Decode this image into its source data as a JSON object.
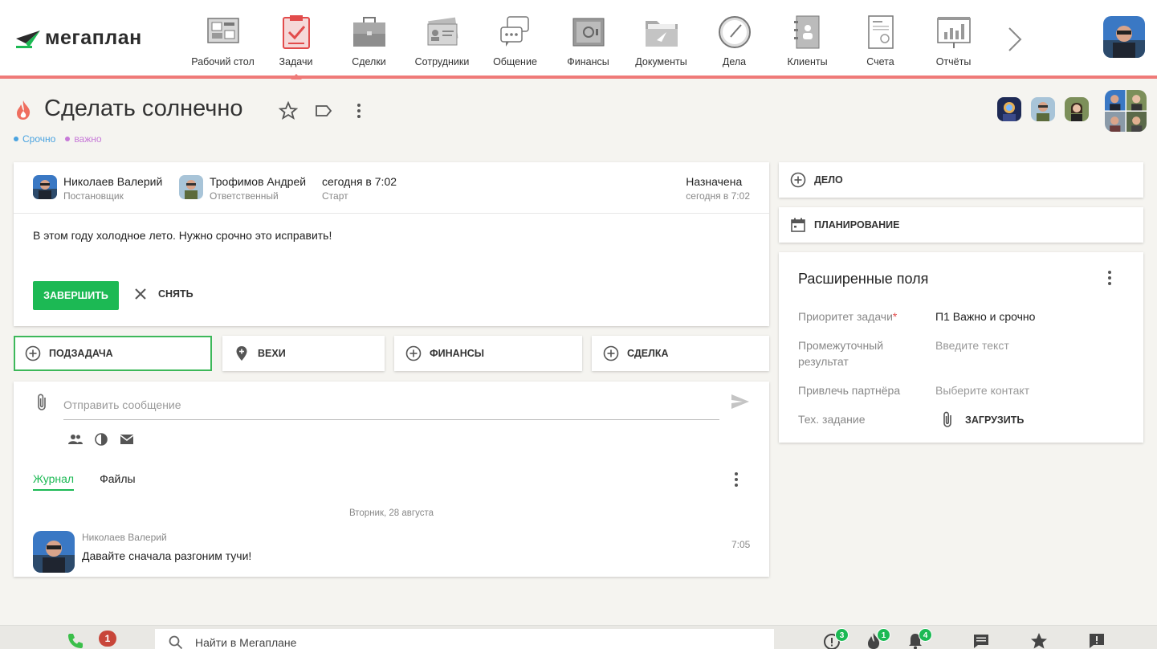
{
  "app": {
    "logo_text": "мегаплан",
    "accent_color": "#1cb954",
    "brand_bar_color": "#ef7a78"
  },
  "nav": {
    "items": [
      {
        "label": "Рабочий стол",
        "icon": "desktop-icon"
      },
      {
        "label": "Задачи",
        "icon": "tasks-clipboard-icon",
        "active": true
      },
      {
        "label": "Сделки",
        "icon": "briefcase-icon"
      },
      {
        "label": "Сотрудники",
        "icon": "id-card-icon"
      },
      {
        "label": "Общение",
        "icon": "chat-bubbles-icon"
      },
      {
        "label": "Финансы",
        "icon": "safe-icon"
      },
      {
        "label": "Документы",
        "icon": "folder-icon"
      },
      {
        "label": "Дела",
        "icon": "clock-icon"
      },
      {
        "label": "Клиенты",
        "icon": "contacts-book-icon"
      },
      {
        "label": "Счета",
        "icon": "invoice-icon"
      },
      {
        "label": "Отчёты",
        "icon": "report-chart-icon"
      }
    ]
  },
  "task": {
    "title": "Сделать солнечно",
    "tags": [
      {
        "label": "Срочно",
        "color": "#4aa3e0"
      },
      {
        "label": "важно",
        "color": "#c77ad8"
      }
    ],
    "owner": {
      "name": "Николаев Валерий",
      "role": "Постановщик"
    },
    "responsible": {
      "name": "Трофимов Андрей",
      "role": "Ответственный"
    },
    "start": {
      "value": "сегодня в 7:02",
      "label": "Старт"
    },
    "status": {
      "value": "Назначена",
      "time": "сегодня в 7:02"
    },
    "description": "В этом году холодное лето. Нужно срочно это исправить!",
    "complete_label": "ЗАВЕРШИТЬ",
    "remove_label": "СНЯТЬ"
  },
  "chips": {
    "subtask": "ПОДЗАДАЧА",
    "milestones": "ВЕХИ",
    "finance": "ФИНАНСЫ",
    "deal": "СДЕЛКА"
  },
  "message": {
    "placeholder": "Отправить сообщение"
  },
  "journal": {
    "tabs": [
      "Журнал",
      "Файлы"
    ],
    "date_separator": "Вторник, 28 августа",
    "entries": [
      {
        "author": "Николаев Валерий",
        "text": "Давайте сначала разгоним тучи!",
        "time": "7:05"
      }
    ]
  },
  "side": {
    "task_button": "ДЕЛО",
    "planning_button": "ПЛАНИРОВАНИЕ",
    "ext_title": "Расширенные поля",
    "fields": {
      "priority_label": "Приоритет задачи",
      "priority_required": "*",
      "priority_value": "П1 Важно и срочно",
      "interim_label_line1": "Промежуточный",
      "interim_label_line2": "результат",
      "interim_placeholder": "Введите текст",
      "partner_label": "Привлечь партнёра",
      "partner_placeholder": "Выберите контакт",
      "spec_label": "Тех. задание",
      "upload_label": "ЗАГРУЗИТЬ"
    }
  },
  "bottom": {
    "calls_badge": "1",
    "search_placeholder": "Найти в Мегаплане",
    "badges": {
      "alerts": "3",
      "hot": "1",
      "notifications": "4"
    }
  }
}
